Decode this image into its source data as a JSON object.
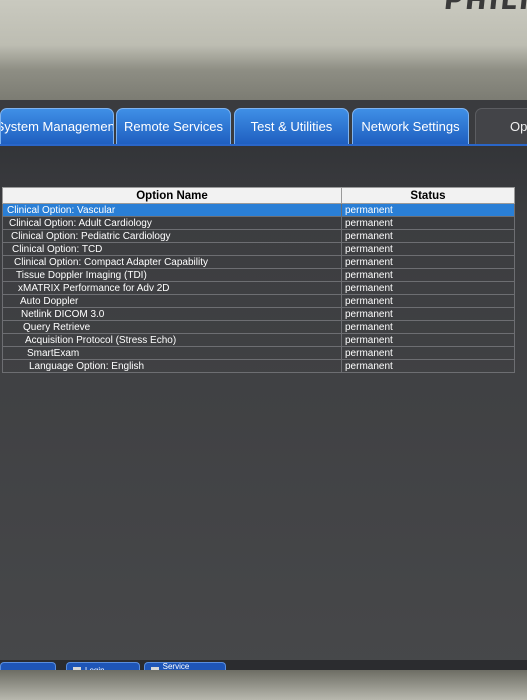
{
  "brand": {
    "logo_text": "PHILI"
  },
  "tabs": [
    {
      "label": "System Management"
    },
    {
      "label": "Remote Services"
    },
    {
      "label": "Test & Utilities"
    },
    {
      "label": "Network Settings"
    },
    {
      "label": "Opt"
    }
  ],
  "options_table": {
    "columns": [
      "Option Name",
      "Status"
    ],
    "rows": [
      {
        "name": "Clinical Option: Vascular",
        "status": "permanent",
        "selected": true
      },
      {
        "name": "Clinical Option: Adult Cardiology",
        "status": "permanent"
      },
      {
        "name": "Clinical Option: Pediatric Cardiology",
        "status": "permanent"
      },
      {
        "name": "Clinical Option: TCD",
        "status": "permanent"
      },
      {
        "name": "Clinical Option: Compact Adapter Capability",
        "status": "permanent"
      },
      {
        "name": "Tissue Doppler Imaging (TDI)",
        "status": "permanent"
      },
      {
        "name": "xMATRIX Performance for Adv 2D",
        "status": "permanent"
      },
      {
        "name": "Auto Doppler",
        "status": "permanent"
      },
      {
        "name": "Netlink DICOM 3.0",
        "status": "permanent"
      },
      {
        "name": "Query Retrieve",
        "status": "permanent"
      },
      {
        "name": "Acquisition Protocol (Stress Echo)",
        "status": "permanent"
      },
      {
        "name": "SmartExam",
        "status": "permanent"
      },
      {
        "name": "Language Option: English",
        "status": "permanent"
      }
    ]
  },
  "bottom_bar": {
    "login_label": "Login",
    "service_messages_label": "Service Messages"
  },
  "colors": {
    "tab_blue": "#2f7ad8",
    "selection_blue": "#2a7fd6"
  }
}
